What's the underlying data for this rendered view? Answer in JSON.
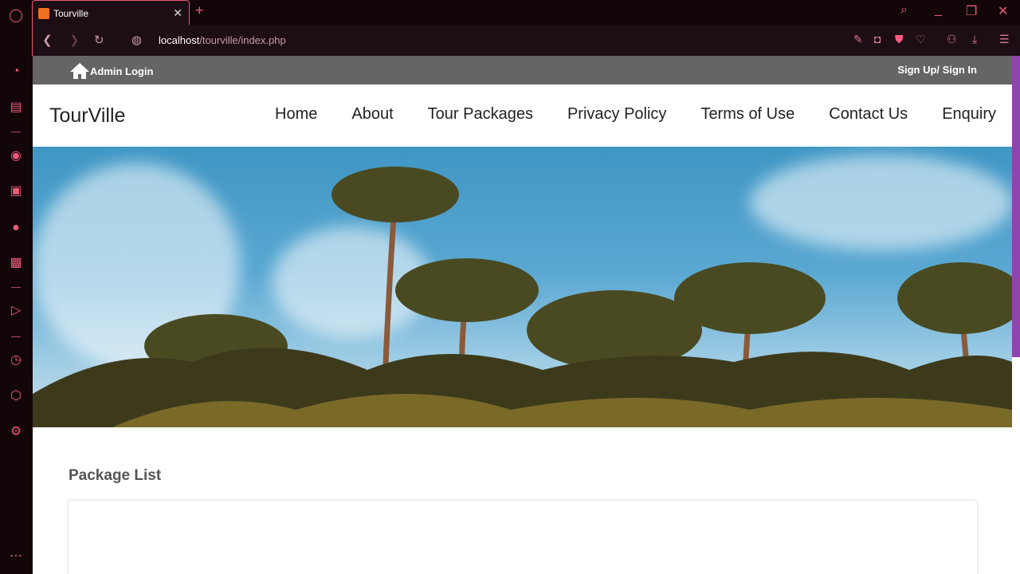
{
  "browser": {
    "tab_title": "Tourville",
    "url_host": "localhost",
    "url_path": "/tourville/index.php"
  },
  "topbar": {
    "admin_login": "Admin Login",
    "signin": "Sign Up/ Sign In"
  },
  "header": {
    "logo": "TourVille",
    "menu": [
      "Home",
      "About",
      "Tour Packages",
      "Privacy Policy",
      "Terms of Use",
      "Contact Us",
      "Enquiry"
    ]
  },
  "main": {
    "section_title": "Package List"
  },
  "colors": {
    "accent": "#e85a78",
    "topbar": "#656563",
    "scroll": "#8e44ad"
  }
}
